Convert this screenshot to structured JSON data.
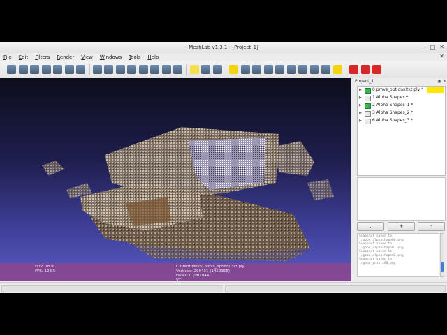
{
  "window": {
    "title": "MeshLab v1.3.1 - [Project_1]",
    "controls": [
      "–",
      "□",
      "✕"
    ]
  },
  "menu": {
    "items": [
      "File",
      "Edit",
      "Filters",
      "Render",
      "View",
      "Windows",
      "Tools",
      "Help"
    ],
    "close_glyph": "✕"
  },
  "toolbar": {
    "icons": [
      "new-project-icon",
      "open-icon",
      "import-mesh-icon",
      "reload-icon",
      "export-mesh-icon",
      "save-snapshot-icon",
      "layers-icon",
      "sep",
      "bbox-icon",
      "points-icon",
      "wireframe-icon",
      "hidden-lines-icon",
      "flat-lines-icon",
      "flat-icon",
      "smooth-icon",
      "texture-icon",
      "sep",
      "light-icon",
      "double-side-icon",
      "fancy-light-icon",
      "sep",
      "annotate-icon",
      "measure-icon",
      "paint-icon",
      "select-vertex-icon",
      "color-icon",
      "align-icon",
      "pick-points-icon",
      "manipulator-icon",
      "texture-edit-icon",
      "info-icon",
      "sep",
      "delete-face-icon",
      "delete-vertex-icon",
      "delete-selected-icon"
    ],
    "colors": {
      "light-icon": "#f2e04a",
      "annotate-icon": "#f3d40f",
      "info-icon": "#f3d40f",
      "delete-face-icon": "#d92626",
      "delete-vertex-icon": "#d92626",
      "delete-selected-icon": "#d92626",
      "default": "#6e8fb3"
    }
  },
  "viewport": {
    "fov_label": "FOV:",
    "fov_value": "78.9",
    "fps_label": "FPS:",
    "fps_value": "123.5",
    "current_mesh": "Current Mesh: pmvs_options.txt.ply",
    "vertices": "Vertices: 290431 (1452155)",
    "faces": "Faces: 0 (901044)",
    "extra": "VC",
    "overlay_color": "#8c468c"
  },
  "panel": {
    "title": "Project_1",
    "header_buttons": "▣ ✕",
    "layers": [
      {
        "label": "0 pmvs_options.txt.ply *",
        "visible": true,
        "selected": true
      },
      {
        "label": "1 Alpha Shapes *",
        "visible": false,
        "selected": false
      },
      {
        "label": "2 Alpha Shapes_1 *",
        "visible": true,
        "selected": false
      },
      {
        "label": "3 Alpha Shapes_2 *",
        "visible": false,
        "selected": false
      },
      {
        "label": "6 Alpha Shapes_3 *",
        "visible": false,
        "selected": false
      }
    ],
    "buttons": [
      "...",
      "+",
      "-"
    ],
    "log": [
      "Snapshot saved to",
      "./gbox_alphashape00.png",
      "Snapshot saved to",
      "./gbox_alphashape01.png",
      "Snapshot saved to",
      "./gbox_alphashape02.png",
      "Snapshot saved to",
      "./gbox_points00.png"
    ]
  }
}
